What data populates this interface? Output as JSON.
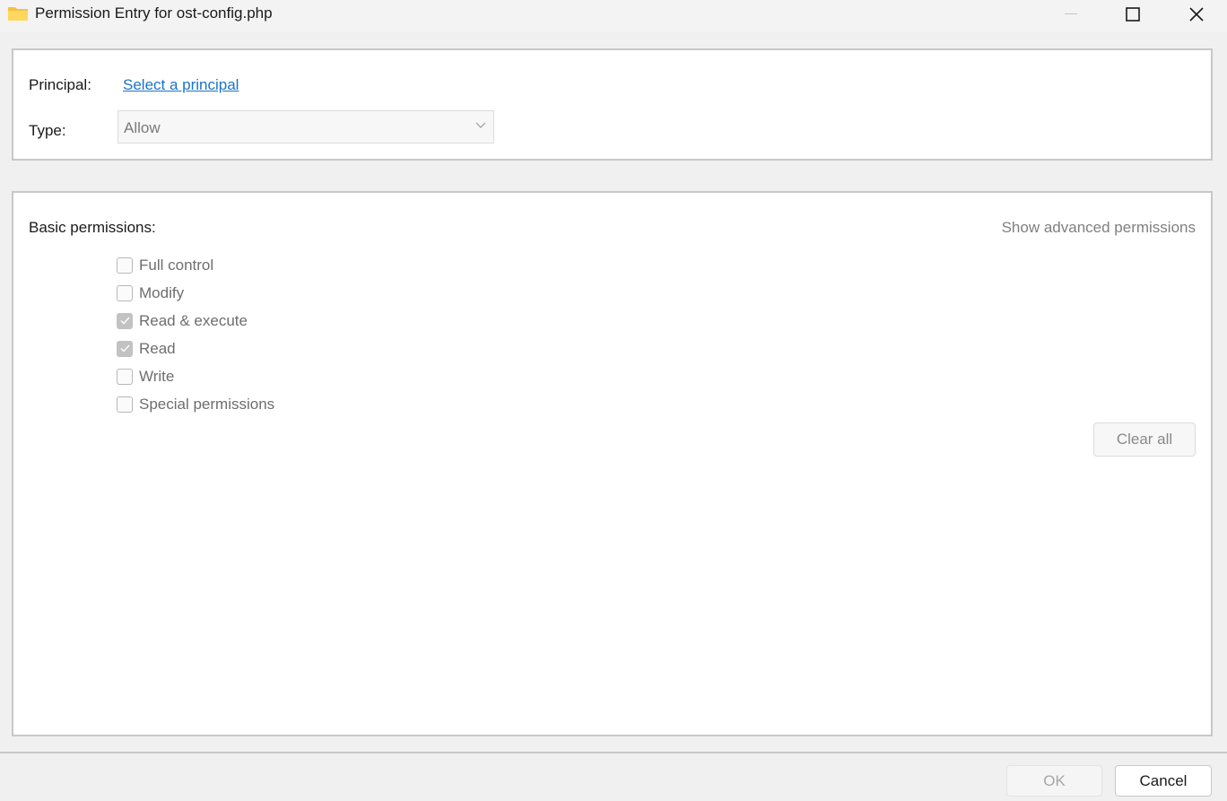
{
  "window": {
    "title": "Permission Entry for ost-config.php",
    "icon": "folder-icon",
    "controls": [
      "minimize-icon",
      "maximize-icon",
      "close-icon"
    ]
  },
  "principal": {
    "label": "Principal:",
    "link_text": "Select a principal"
  },
  "type": {
    "label": "Type:",
    "selected": "Allow"
  },
  "permissions": {
    "label": "Basic permissions:",
    "advanced_link": "Show advanced permissions",
    "items": [
      {
        "label": "Full control",
        "checked": false
      },
      {
        "label": "Modify",
        "checked": false
      },
      {
        "label": "Read & execute",
        "checked": true
      },
      {
        "label": "Read",
        "checked": true
      },
      {
        "label": "Write",
        "checked": false
      },
      {
        "label": "Special permissions",
        "checked": false
      }
    ],
    "clear_all": "Clear all"
  },
  "footer": {
    "ok": "OK",
    "cancel": "Cancel"
  },
  "colors": {
    "link": "#1a73c8",
    "disabled_text": "#6e6e6e",
    "checked_box": "#c2c2c2"
  }
}
